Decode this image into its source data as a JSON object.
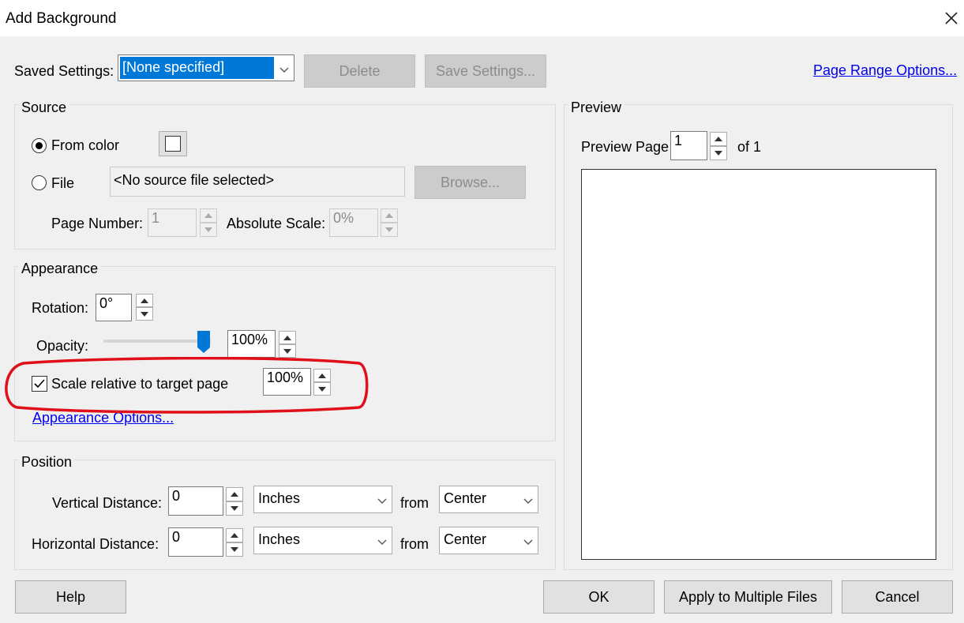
{
  "window": {
    "title": "Add Background"
  },
  "saved_settings": {
    "label": "Saved Settings:",
    "selected": "[None specified]",
    "delete_label": "Delete",
    "save_label": "Save Settings...",
    "page_range_link": "Page Range Options..."
  },
  "source": {
    "title": "Source",
    "from_color_label": "From color",
    "from_color_selected": true,
    "color_swatch": "#ffffff",
    "file_label": "File",
    "file_value": "<No source file selected>",
    "browse_label": "Browse...",
    "page_number_label": "Page Number:",
    "page_number_value": "1",
    "absolute_scale_label": "Absolute Scale:",
    "absolute_scale_value": "0%"
  },
  "appearance": {
    "title": "Appearance",
    "rotation_label": "Rotation:",
    "rotation_value": "0°",
    "opacity_label": "Opacity:",
    "opacity_value": "100%",
    "opacity_level": 1.0,
    "scale_label": "Scale relative to target page",
    "scale_checked": true,
    "scale_value": "100%",
    "options_link": "Appearance Options...",
    "highlight_color": "#e0101a"
  },
  "position": {
    "title": "Position",
    "vertical_label": "Vertical Distance:",
    "vertical_value": "0",
    "vertical_unit": "Inches",
    "vertical_from_label": "from",
    "vertical_from": "Center",
    "horizontal_label": "Horizontal Distance:",
    "horizontal_value": "0",
    "horizontal_unit": "Inches",
    "horizontal_from_label": "from",
    "horizontal_from": "Center"
  },
  "preview": {
    "title": "Preview",
    "page_label": "Preview Page",
    "page_value": "1",
    "of_label": "of 1"
  },
  "footer": {
    "help_label": "Help",
    "ok_label": "OK",
    "apply_multiple_label": "Apply to Multiple Files",
    "cancel_label": "Cancel"
  },
  "colors": {
    "accent": "#0078d7",
    "link": "#0000ee",
    "dialog_bg": "#f0f0f0"
  }
}
